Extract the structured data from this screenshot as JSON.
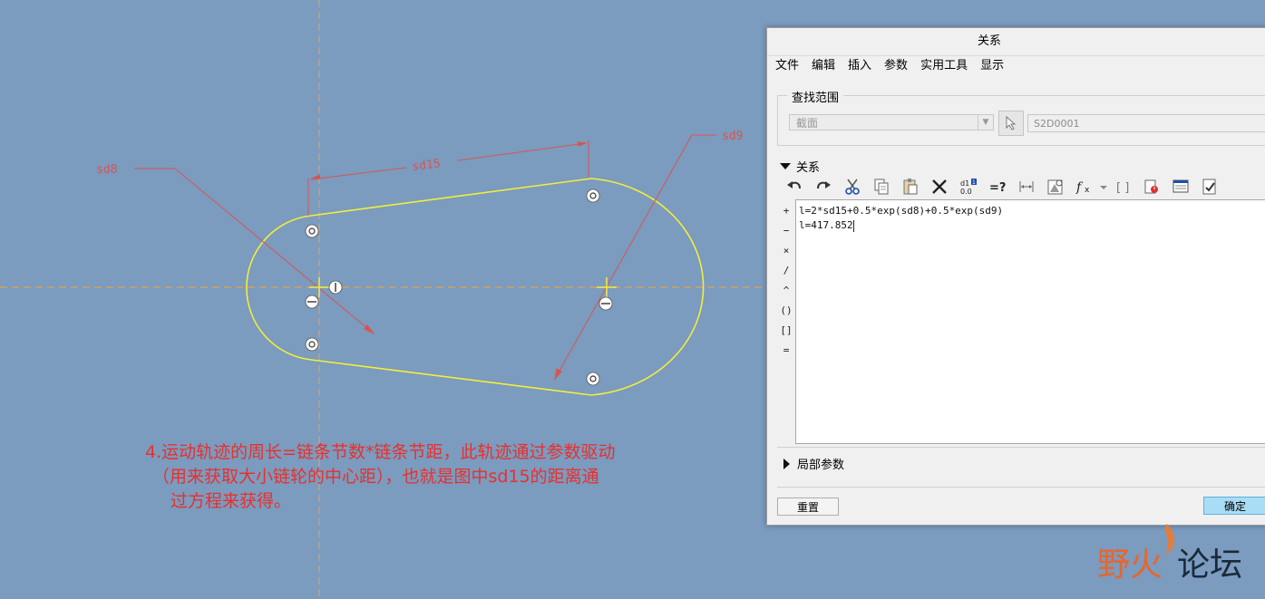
{
  "sketch": {
    "dimension_labels": {
      "sd8": "sd8",
      "sd9": "sd9",
      "sd15": "sd15"
    },
    "colors": {
      "background": "#7b9bbf",
      "profile": "#f2ee3a",
      "dimension": "#d9544f",
      "centerline": "#e8a04a"
    }
  },
  "note": {
    "line1": "4.运动轨迹的周长=链条节数*链条节距，此轨迹通过参数驱动",
    "line2": "（用来获取大小链轮的中心距），也就是图中sd15的距离通",
    "line3": "过方程来获得。"
  },
  "dialog": {
    "title": "关系",
    "menu": [
      "文件",
      "编辑",
      "插入",
      "参数",
      "实用工具",
      "显示"
    ],
    "search_group_label": "查找范围",
    "scope_value": "截面",
    "selected_item": "S2D0001",
    "relations_label": "关系",
    "toolbar_icons": [
      "undo-icon",
      "redo-icon",
      "cut-icon",
      "copy-icon",
      "paste-icon",
      "delete-icon",
      "sort-icon",
      "evaluate-icon",
      "dimension-icon",
      "verify-icon",
      "function-icon",
      "bracket-icon",
      "units-icon",
      "display-icon",
      "check-icon"
    ],
    "operators": [
      "+",
      "−",
      "×",
      "/",
      "^",
      "()",
      "[]",
      "="
    ],
    "relations": [
      "l=2*sd15+0.5*exp(sd8)+0.5*exp(sd9)",
      "l=417.852"
    ],
    "local_params_label": "局部参数",
    "reset_label": "重置",
    "ok_label": "确定"
  },
  "watermark": {
    "text1": "野火",
    "text2": "论坛"
  }
}
